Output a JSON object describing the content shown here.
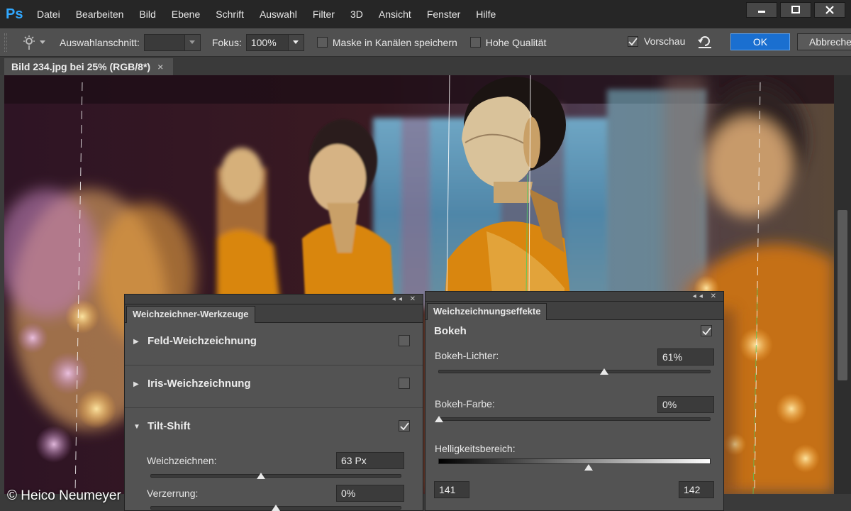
{
  "app": {
    "logo": "Ps"
  },
  "menu": [
    "Datei",
    "Bearbeiten",
    "Bild",
    "Ebene",
    "Schrift",
    "Auswahl",
    "Filter",
    "3D",
    "Ansicht",
    "Fenster",
    "Hilfe"
  ],
  "window_controls": {
    "minimize_icon": "minimize-icon",
    "maximize_icon": "maximize-icon",
    "close_icon": "close-icon"
  },
  "options": {
    "selection_label": "Auswahlanschnitt:",
    "selection_value": "",
    "focus_label": "Fokus:",
    "focus_value": "100%",
    "mask_label": "Maske in Kanälen speichern",
    "mask_checked": false,
    "quality_label": "Hohe Qualität",
    "quality_checked": false,
    "preview_label": "Vorschau",
    "preview_checked": true,
    "ok_label": "OK",
    "cancel_label": "Abbrechen"
  },
  "document_tab": {
    "title": "Bild 234.jpg bei 25% (RGB/8*)",
    "close": "×"
  },
  "blur_tools_panel": {
    "tab": "Weichzeichner-Werkzeuge",
    "sections": [
      {
        "title": "Feld-Weichzeichnung",
        "expanded": false,
        "checked": false
      },
      {
        "title": "Iris-Weichzeichnung",
        "expanded": false,
        "checked": false
      },
      {
        "title": "Tilt-Shift",
        "expanded": true,
        "checked": true
      }
    ],
    "blur_label": "Weichzeichnen:",
    "blur_value": "63 Px",
    "blur_slider_fraction": 0.44,
    "distortion_label": "Verzerrung:",
    "distortion_value": "0%",
    "distortion_slider_fraction": 0.5
  },
  "effects_panel": {
    "tab": "Weichzeichnungseffekte",
    "bokeh_title": "Bokeh",
    "bokeh_checked": true,
    "lights_label": "Bokeh-Lichter:",
    "lights_value": "61%",
    "lights_fraction": 0.61,
    "color_label": "Bokeh-Farbe:",
    "color_value": "0%",
    "color_fraction": 0.0,
    "range_label": "Helligkeitsbereich:",
    "range_low": "141",
    "range_high": "142",
    "range_fraction": 0.553
  },
  "watermark": "© Heico Neumeyer",
  "colors": {
    "accent": "#1a6fd0",
    "robe": "#d9860f",
    "gold": "#c9a067"
  }
}
